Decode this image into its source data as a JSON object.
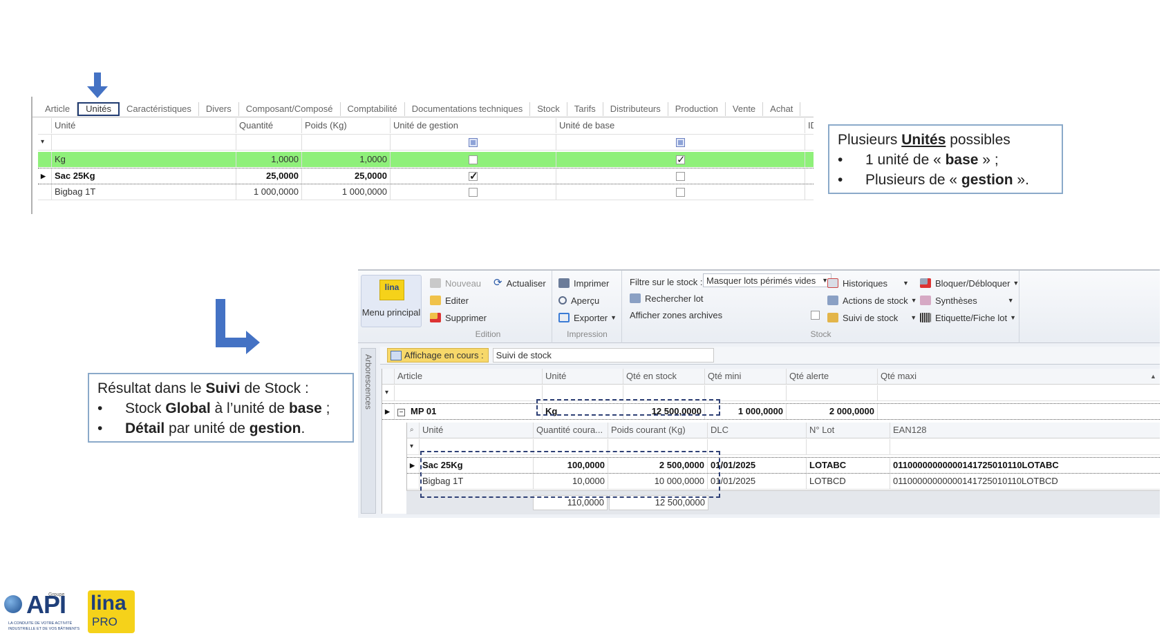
{
  "top_grid": {
    "tabs": [
      "Article",
      "Unités",
      "Caractéristiques",
      "Divers",
      "Composant/Composé",
      "Comptabilité",
      "Documentations techniques",
      "Stock",
      "Tarifs",
      "Distributeurs",
      "Production",
      "Vente",
      "Achat"
    ],
    "active_tab": "Unités",
    "columns": [
      "Unité",
      "Quantité",
      "Poids (Kg)",
      "Unité de gestion",
      "Unité de base",
      "ID"
    ],
    "rows": [
      {
        "unite": "Kg",
        "quantite": "1,0000",
        "poids": "1,0000",
        "gestion": false,
        "base": true,
        "highlight": true
      },
      {
        "unite": "Sac 25Kg",
        "quantite": "25,0000",
        "poids": "25,0000",
        "gestion": true,
        "base": false,
        "bold": true
      },
      {
        "unite": "Bigbag 1T",
        "quantite": "1 000,0000",
        "poids": "1 000,0000",
        "gestion": false,
        "base": false
      }
    ]
  },
  "callout_units": {
    "line1_pre": "Plusieurs ",
    "line1_bold": "Unités",
    "line1_post": " possibles",
    "bullet": "•",
    "item1_pre": "1 unité de « ",
    "item1_bold": "base",
    "item1_post": " » ;",
    "item2_pre": "Plusieurs de « ",
    "item2_bold": "gestion",
    "item2_post": " »."
  },
  "callout_result": {
    "line1_pre": "Résultat dans le ",
    "line1_bold": "Suivi",
    "line1_post": " de Stock :",
    "bullet": "•",
    "item1_pre": "Stock ",
    "item1_bold": "Global",
    "item1_mid": " à l’unité de ",
    "item1_bold2": "base",
    "item1_post": " ;",
    "item2_bold": "Détail",
    "item2_mid": " par unité de ",
    "item2_bold2": "gestion",
    "item2_post": "."
  },
  "ribbon": {
    "menu_logo": "lina",
    "menu_label": "Menu principal",
    "nouveau": "Nouveau",
    "actualiser": "Actualiser",
    "editer": "Editer",
    "supprimer": "Supprimer",
    "group_edition": "Edition",
    "imprimer": "Imprimer",
    "apercu": "Aperçu",
    "exporter": "Exporter",
    "group_impression": "Impression",
    "filtre_label": "Filtre sur le stock :",
    "filtre_value": "Masquer lots périmés vides",
    "rechercher_lot": "Rechercher lot",
    "afficher_archives": "Afficher zones archives",
    "historiques": "Historiques",
    "actions_stock": "Actions de stock",
    "suivi_stock": "Suivi de stock",
    "bloquer": "Bloquer/Débloquer",
    "syntheses": "Synthèses",
    "etiquette": "Etiquette/Fiche lot",
    "group_stock": "Stock"
  },
  "side_tab": "Arborescences",
  "view_bar": {
    "label": "Affichage en cours :",
    "value": "Suivi de stock"
  },
  "stock_grid": {
    "columns": [
      "Article",
      "Unité",
      "Qté en stock",
      "Qté mini",
      "Qté alerte",
      "Qté maxi"
    ],
    "main_row": {
      "article": "MP 01",
      "unite": "Kg",
      "qte_stock": "12 500,0000",
      "qte_mini": "1 000,0000",
      "qte_alerte": "2 000,0000",
      "qte_maxi": ""
    },
    "sub_columns": [
      "Unité",
      "Quantité coura...",
      "Poids courant (Kg)",
      "DLC",
      "N° Lot",
      "EAN128"
    ],
    "sub_rows": [
      {
        "unite": "Sac 25Kg",
        "quantite": "100,0000",
        "poids": "2 500,0000",
        "dlc": "01/01/2025",
        "lot": "LOTABC",
        "ean": "01100000000000141725010110LOTABC",
        "bold": true
      },
      {
        "unite": "Bigbag 1T",
        "quantite": "10,0000",
        "poids": "10 000,0000",
        "dlc": "01/01/2025",
        "lot": "LOTBCD",
        "ean": "01100000000000141725010110LOTBCD"
      }
    ],
    "totals": {
      "quantite": "110,0000",
      "poids": "12 500,0000"
    }
  },
  "logos": {
    "api_group": "Groupe",
    "api_text": "API",
    "api_tagline_1": "LA CONDUITE DE VOTRE ACTIVITÉ",
    "api_tagline_2": "INDUSTRIELLE ET DE VOS BÂTIMENTS",
    "lina_text": "lina",
    "lina_pro": "PRO"
  },
  "colors": {
    "highlight_row": "#8ff07a",
    "callout_border": "#8aa9c9",
    "arrow": "#4472c4",
    "dash": "#2d3f75",
    "ribbon_bg": "#eef1f6"
  }
}
